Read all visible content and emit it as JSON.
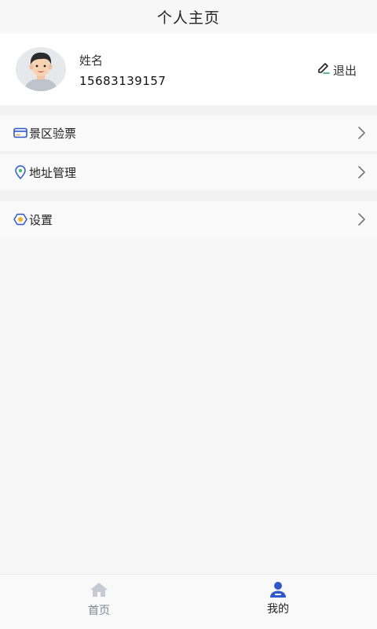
{
  "header": {
    "title": "个人主页"
  },
  "profile": {
    "name": "姓名",
    "phone": "15683139157",
    "logout_label": "退出"
  },
  "menu": [
    {
      "label": "景区验票",
      "icon": "ticket-card-icon"
    },
    {
      "label": "地址管理",
      "icon": "location-pin-icon"
    },
    {
      "label": "设置",
      "icon": "settings-hexagon-icon"
    }
  ],
  "tabbar": {
    "tabs": [
      {
        "label": "首页",
        "icon": "home-icon",
        "active": false
      },
      {
        "label": "我的",
        "icon": "user-icon",
        "active": true
      }
    ]
  },
  "colors": {
    "accent": "#2f58c9",
    "inactive_tab": "#7d8594",
    "background": "#f7f7f7"
  }
}
